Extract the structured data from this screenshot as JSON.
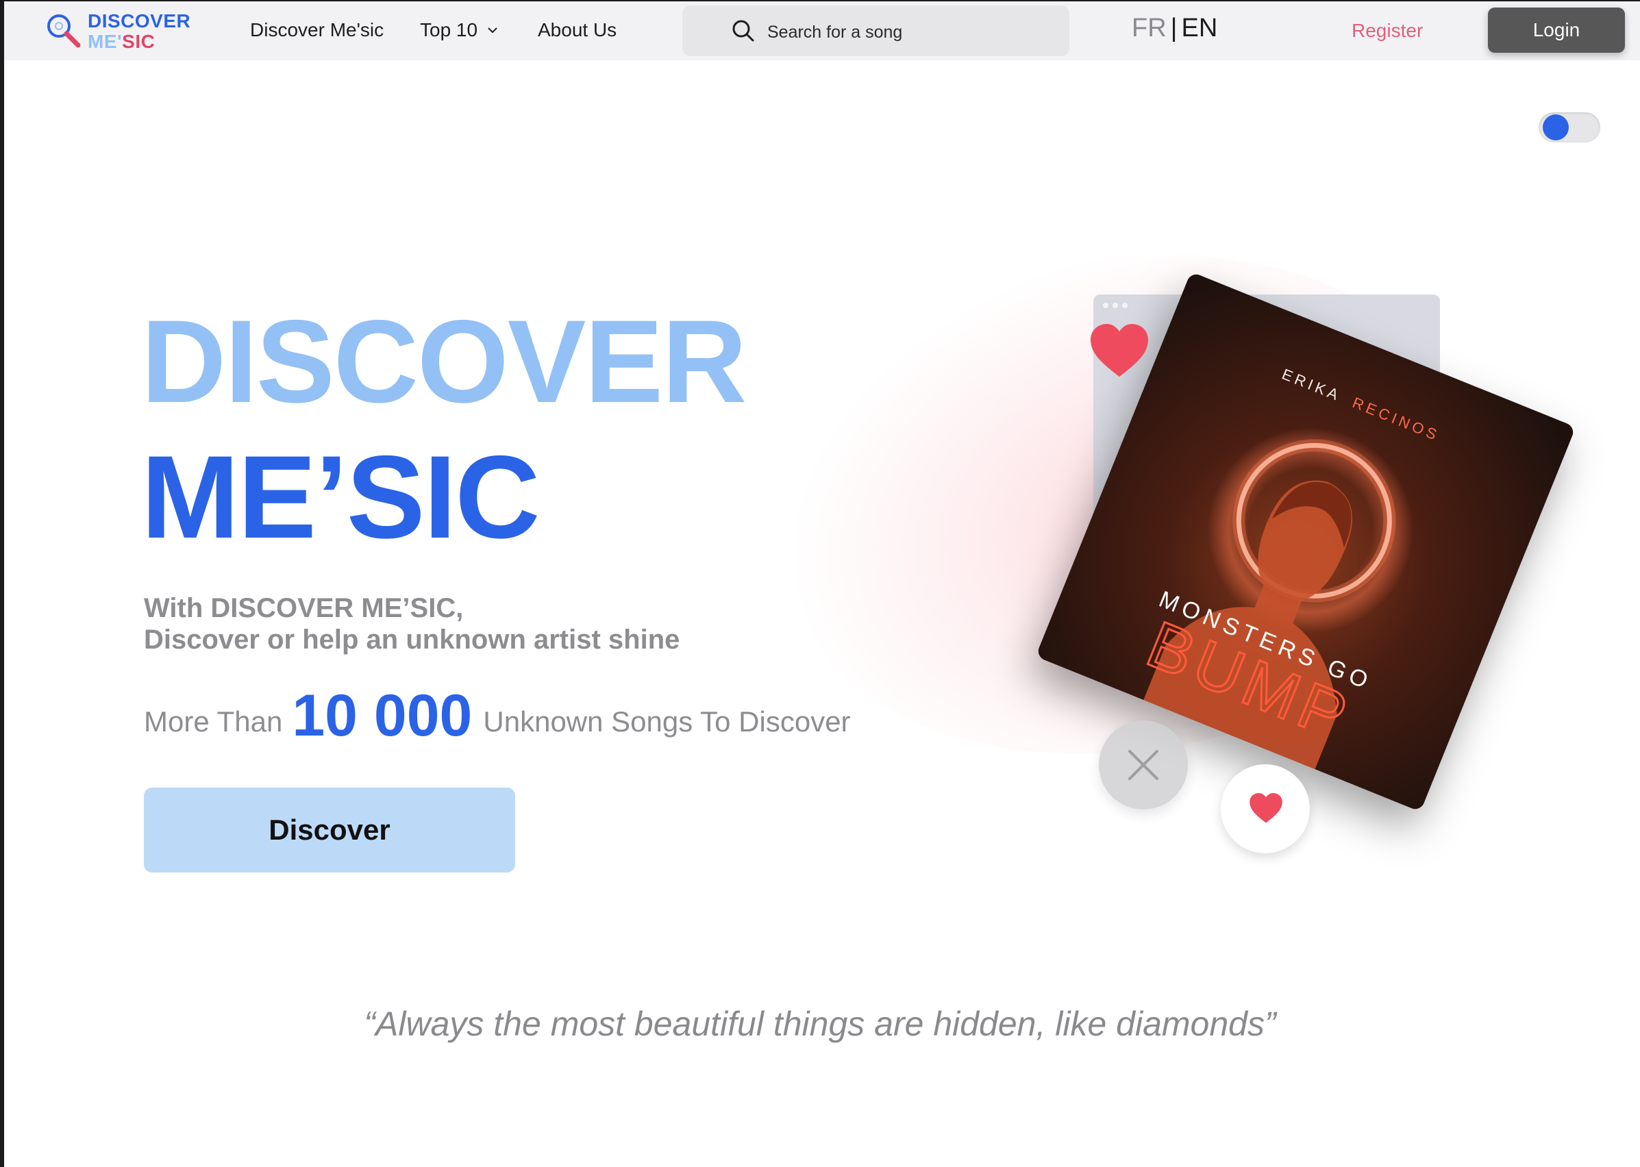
{
  "navbar": {
    "logo": {
      "line1": "DISCOVER",
      "line2a": "ME'",
      "line2b": "SIC",
      "icon": "magnifier-logo-icon"
    },
    "links": {
      "discover": "Discover Me'sic",
      "top10": "Top 10",
      "about": "About Us"
    },
    "search": {
      "placeholder": "Search for a song",
      "icon": "search-icon"
    },
    "lang": {
      "fr": "FR",
      "sep": "|",
      "en": "EN"
    },
    "register": "Register",
    "login": "Login"
  },
  "toggle": {
    "state": "on",
    "accent": "#2b63e6"
  },
  "hero": {
    "title_line1": "DISCOVER",
    "title_line2": "ME’SIC",
    "subtitle_line1": "With DISCOVER ME’SIC,",
    "subtitle_line2": "Discover or help an unknown artist shine",
    "stats_prefix": "More Than",
    "stats_number": "10 000",
    "stats_suffix": "Unknown Songs To Discover",
    "cta": "Discover",
    "quote": "“Always the most beautiful things are hidden, like diamonds”"
  },
  "album": {
    "artist_first": "ERIKA",
    "artist_last": "RECINOS",
    "title_line1": "MONSTERS GO",
    "title_line2": "BUMP"
  },
  "icons": {
    "like": "heart-icon",
    "dislike": "close-icon",
    "dropdown": "chevron-down-icon"
  },
  "colors": {
    "light_blue": "#93c0f5",
    "blue": "#2b63e6",
    "pink": "#e2456a",
    "heart_red": "#ef4b5f",
    "cta_bg": "#bcdaf8"
  }
}
